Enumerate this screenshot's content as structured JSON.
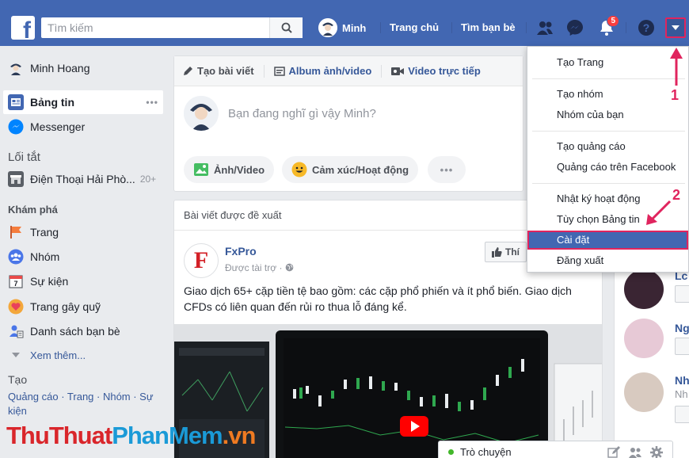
{
  "topbar": {
    "search_placeholder": "Tìm kiếm",
    "user_name": "Minh",
    "home_label": "Trang chủ",
    "find_friends_label": "Tìm bạn bè",
    "notification_count": "5",
    "colors": {
      "bar": "#4267b2",
      "accent": "#e0245e"
    }
  },
  "sidebar": {
    "profile_name": "Minh Hoang",
    "items": [
      {
        "label": "Bảng tin",
        "icon": "news-feed-icon",
        "more": "•••"
      },
      {
        "label": "Messenger",
        "icon": "messenger-icon"
      }
    ],
    "shortcuts_heading": "Lối tắt",
    "shortcuts": [
      {
        "label": "Điện Thoại Hải Phò...",
        "count": "20+",
        "icon": "shop-icon"
      }
    ],
    "explore_heading": "Khám phá",
    "explore": [
      {
        "label": "Trang",
        "icon": "flag-icon"
      },
      {
        "label": "Nhóm",
        "icon": "groups-icon"
      },
      {
        "label": "Sự kiện",
        "icon": "calendar-icon"
      },
      {
        "label": "Trang gây quỹ",
        "icon": "fundraiser-icon"
      },
      {
        "label": "Danh sách bạn bè",
        "icon": "friends-list-icon"
      }
    ],
    "see_more": "Xem thêm...",
    "create_heading": "Tạo",
    "create_links": "Quảng cáo · Trang · Nhóm · Sự kiện"
  },
  "composer": {
    "tabs": [
      {
        "label": "Tạo bài viết",
        "icon": "pencil-icon"
      },
      {
        "label": "Album ảnh/video",
        "icon": "album-icon"
      },
      {
        "label": "Video trực tiếp",
        "icon": "live-video-icon"
      }
    ],
    "placeholder": "Bạn đang nghĩ gì vậy Minh?",
    "actions": [
      {
        "label": "Ảnh/Video",
        "icon": "photo-icon"
      },
      {
        "label": "Cảm xúc/Hoạt động",
        "icon": "smile-icon"
      },
      {
        "label": "•••",
        "icon": "more-icon"
      }
    ]
  },
  "post": {
    "header": "Bài viết được đề xuất",
    "page_name": "FxPro",
    "logo_letter": "F",
    "meta": "Được tài trợ ·",
    "like_button": "Thí",
    "text": "Giao dịch 65+ cặp tiền tệ bao gồm: các cặp phổ phiến và ít phổ biến. Giao dịch CFDs có liên quan đến rủi ro thua lỗ đáng kể."
  },
  "right_column": {
    "peers": [
      {
        "name": "Lc"
      },
      {
        "name": "Ng"
      },
      {
        "name": "Nh",
        "sub": "Nh"
      }
    ]
  },
  "chat": {
    "label": "Trò chuyện"
  },
  "menu": {
    "groups": [
      [
        "Tạo Trang"
      ],
      [
        "Tạo nhóm",
        "Nhóm của bạn"
      ],
      [
        "Tạo quảng cáo",
        "Quảng cáo trên Facebook"
      ],
      [
        "Nhật ký hoạt động",
        "Tùy chọn Bảng tin",
        "Cài đặt",
        "Đăng xuất"
      ]
    ],
    "selected": "Cài đặt"
  },
  "annotations": {
    "step1": "1",
    "step2": "2"
  },
  "watermark": {
    "part1": "Thu",
    "part2": "Thuat",
    "part3": "PhanMem",
    "part4": ".vn"
  }
}
